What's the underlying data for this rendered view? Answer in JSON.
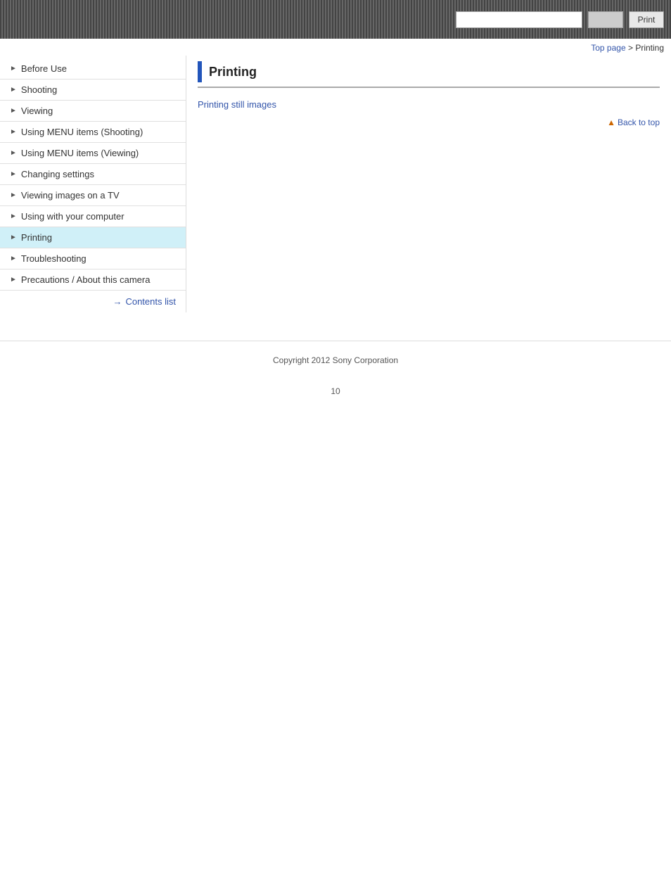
{
  "header": {
    "search_placeholder": "",
    "search_btn_label": "",
    "print_btn_label": "Print"
  },
  "breadcrumb": {
    "top_page_label": "Top page",
    "separator": " > ",
    "current_label": "Printing"
  },
  "sidebar": {
    "items": [
      {
        "id": "before-use",
        "label": "Before Use",
        "active": false
      },
      {
        "id": "shooting",
        "label": "Shooting",
        "active": false
      },
      {
        "id": "viewing",
        "label": "Viewing",
        "active": false
      },
      {
        "id": "using-menu-shooting",
        "label": "Using MENU items (Shooting)",
        "active": false
      },
      {
        "id": "using-menu-viewing",
        "label": "Using MENU items (Viewing)",
        "active": false
      },
      {
        "id": "changing-settings",
        "label": "Changing settings",
        "active": false
      },
      {
        "id": "viewing-images-tv",
        "label": "Viewing images on a TV",
        "active": false
      },
      {
        "id": "using-with-computer",
        "label": "Using with your computer",
        "active": false
      },
      {
        "id": "printing",
        "label": "Printing",
        "active": true
      },
      {
        "id": "troubleshooting",
        "label": "Troubleshooting",
        "active": false
      },
      {
        "id": "precautions",
        "label": "Precautions / About this camera",
        "active": false
      }
    ],
    "contents_link_label": "Contents list"
  },
  "main": {
    "page_title": "Printing",
    "links": [
      {
        "id": "printing-still-images",
        "label": "Printing still images"
      }
    ],
    "back_to_top_label": "Back to top"
  },
  "footer": {
    "copyright": "Copyright 2012 Sony Corporation",
    "page_number": "10"
  }
}
